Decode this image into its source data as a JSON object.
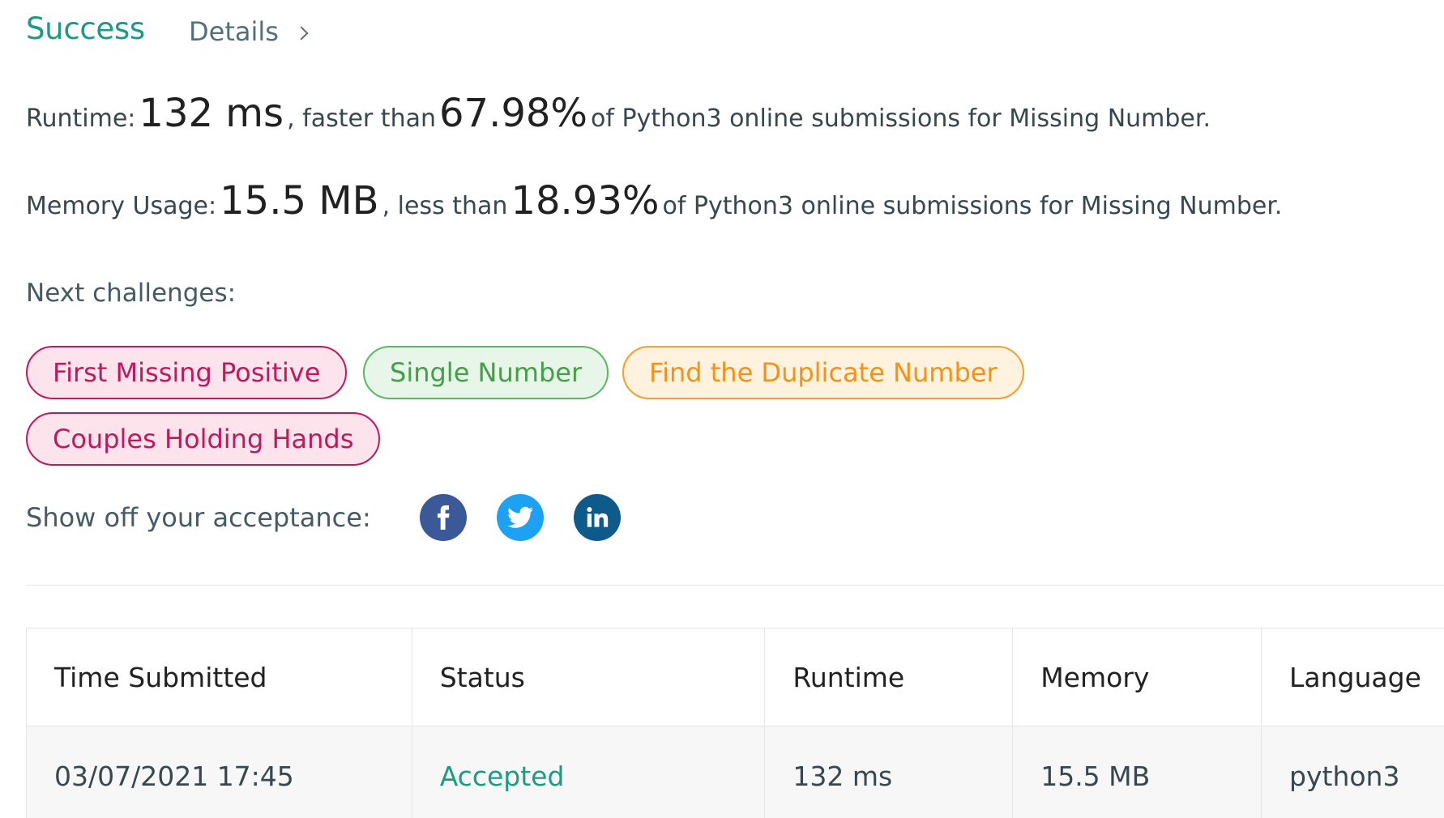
{
  "header": {
    "status": "Success",
    "details_label": "Details"
  },
  "runtime_line": {
    "label": "Runtime:",
    "value": "132 ms",
    "comparison": ", faster than",
    "percent": "67.98%",
    "suffix": "of Python3 online submissions for Missing Number."
  },
  "memory_line": {
    "label": "Memory Usage:",
    "value": "15.5 MB",
    "comparison": ", less than",
    "percent": "18.93%",
    "suffix": "of Python3 online submissions for Missing Number."
  },
  "next_challenges": {
    "label": "Next challenges:",
    "items": [
      {
        "title": "First Missing Positive",
        "difficulty": "hard"
      },
      {
        "title": "Single Number",
        "difficulty": "easy"
      },
      {
        "title": "Find the Duplicate Number",
        "difficulty": "medium"
      },
      {
        "title": "Couples Holding Hands",
        "difficulty": "hard"
      }
    ]
  },
  "share": {
    "label": "Show off your acceptance:",
    "icons": [
      "facebook-icon",
      "twitter-icon",
      "linkedin-icon"
    ]
  },
  "colors": {
    "success": "#1a9c84",
    "hard": "#c2185b",
    "easy": "#43a047",
    "medium": "#f59117"
  },
  "submissions_table": {
    "headers": [
      "Time Submitted",
      "Status",
      "Runtime",
      "Memory",
      "Language"
    ],
    "rows": [
      [
        "03/07/2021 17:45",
        "Accepted",
        "132 ms",
        "15.5 MB",
        "python3"
      ]
    ]
  }
}
